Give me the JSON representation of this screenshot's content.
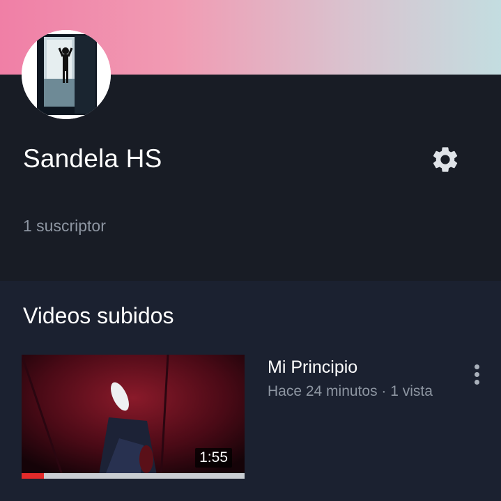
{
  "channel": {
    "name": "Sandela HS",
    "subscribers": "1 suscriptor",
    "settings_icon": "gear-icon"
  },
  "section": {
    "title": "Videos subidos"
  },
  "videos": [
    {
      "title": "Mi Principio",
      "meta": "Hace 24 minutos · 1 vista",
      "duration": "1:55",
      "watched_fraction": 0.1,
      "more_icon": "more-vert-icon"
    }
  ],
  "colors": {
    "header_bg": "#181c25",
    "page_bg": "#1b2130",
    "progress_fill": "#e32a2a",
    "banner_start": "#f07fa6",
    "banner_end": "#c3dde0"
  }
}
